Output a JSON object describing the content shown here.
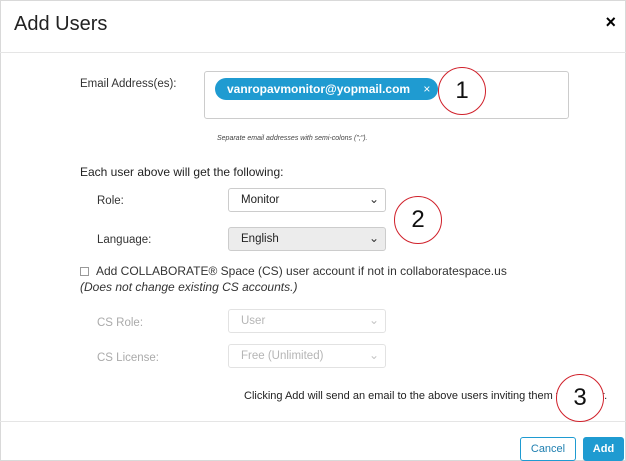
{
  "dialog": {
    "title": "Add Users",
    "close_symbol": "×"
  },
  "email": {
    "label": "Email Address(es):",
    "chips": [
      {
        "value": "vanropavmonitor@yopmail.com",
        "remove_symbol": "×"
      }
    ],
    "hint": "Separate email addresses with semi-colons (\";\")."
  },
  "section_heading": "Each user above will get the following:",
  "role": {
    "label": "Role:",
    "value": "Monitor"
  },
  "language": {
    "label": "Language:",
    "value": "English"
  },
  "cs_checkbox": {
    "checked": false,
    "label": "Add COLLABORATE® Space (CS) user account if not in collaboratespace.us",
    "note": "(Does not change existing CS accounts.)"
  },
  "cs_role": {
    "label": "CS Role:",
    "value": "User"
  },
  "cs_license": {
    "label": "CS License:",
    "value": "Free (Unlimited)"
  },
  "notice": "Clicking Add will send an email to the above users inviting them to register.",
  "buttons": {
    "cancel": "Cancel",
    "add": "Add"
  },
  "callouts": [
    "1",
    "2",
    "3"
  ],
  "colors": {
    "accent": "#1f9bd1",
    "callout_border": "#d0202a"
  }
}
